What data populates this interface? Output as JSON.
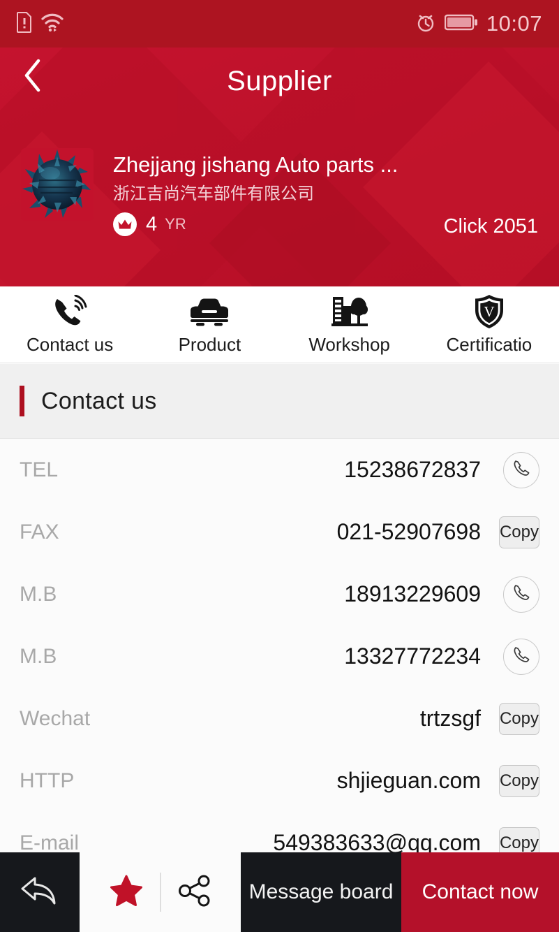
{
  "status_bar": {
    "time": "10:07",
    "icons": [
      "sim-alert-icon",
      "wifi-icon",
      "alarm-icon",
      "battery-icon"
    ]
  },
  "header": {
    "title": "Supplier",
    "back_icon": "chevron-left-icon",
    "background_color": "#c3122c"
  },
  "supplier": {
    "logo_alt": "company-logo",
    "name_en": "Zhejjang jishang Auto parts ...",
    "name_cn": "浙江吉尚汽车部件有限公司",
    "years": "4",
    "years_unit": "YR",
    "badge_icon": "crown-icon",
    "click_label": "Click 2051"
  },
  "tabs": [
    {
      "label": "Contact us",
      "icon": "phone-ring-icon"
    },
    {
      "label": "Product",
      "icon": "car-icon"
    },
    {
      "label": "Workshop",
      "icon": "factory-tree-icon"
    },
    {
      "label": "Certificatio",
      "icon": "shield-v-icon"
    }
  ],
  "section": {
    "title": "Contact us",
    "accent_color": "#ad1020"
  },
  "contact_rows": [
    {
      "label": "TEL",
      "value": "15238672837",
      "action": "call",
      "action_label": ""
    },
    {
      "label": "FAX",
      "value": "021-52907698",
      "action": "copy",
      "action_label": "Copy"
    },
    {
      "label": "M.B",
      "value": "18913229609",
      "action": "call",
      "action_label": ""
    },
    {
      "label": "M.B",
      "value": "13327772234",
      "action": "call",
      "action_label": ""
    },
    {
      "label": "Wechat",
      "value": "trtzsgf",
      "action": "copy",
      "action_label": "Copy"
    },
    {
      "label": "HTTP",
      "value": "shjieguan.com",
      "action": "copy",
      "action_label": "Copy"
    },
    {
      "label": "E-mail",
      "value": "549383633@qq.com",
      "action": "copy",
      "action_label": "Copy"
    }
  ],
  "bottom_bar": {
    "back_icon": "reply-arrow-icon",
    "favorite_icon": "star-icon",
    "share_icon": "share-nodes-icon",
    "message_label": "Message board",
    "contact_label": "Contact now",
    "contact_color": "#b4112a",
    "dark_color": "#16181c"
  }
}
